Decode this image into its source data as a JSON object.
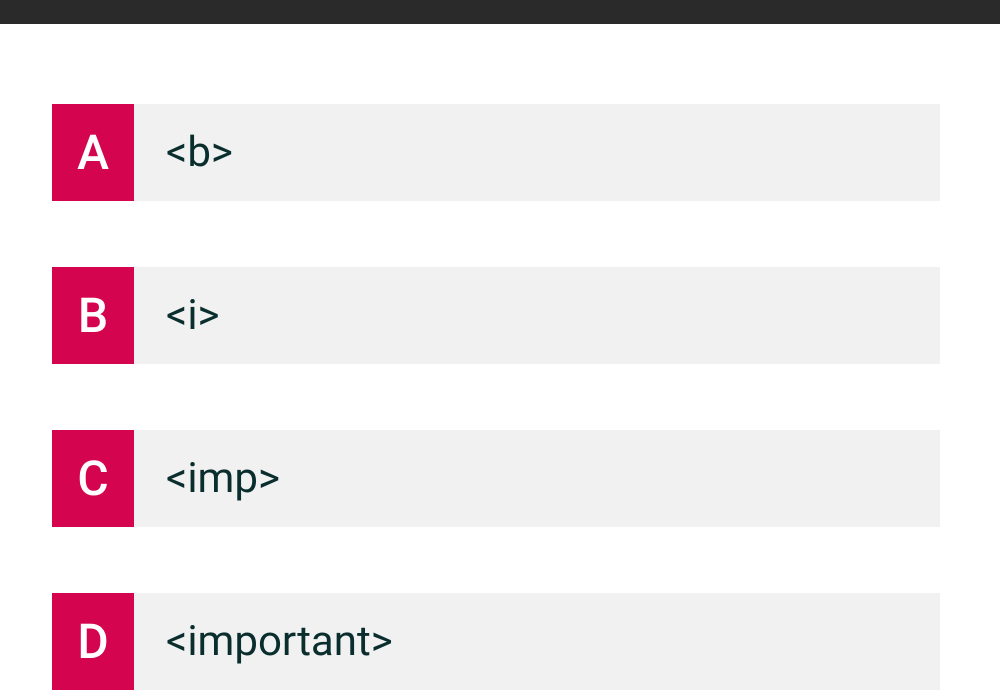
{
  "options": [
    {
      "letter": "A",
      "text": "<b>"
    },
    {
      "letter": "B",
      "text": "<i>"
    },
    {
      "letter": "C",
      "text": "<imp>"
    },
    {
      "letter": "D",
      "text": "<important>"
    }
  ]
}
